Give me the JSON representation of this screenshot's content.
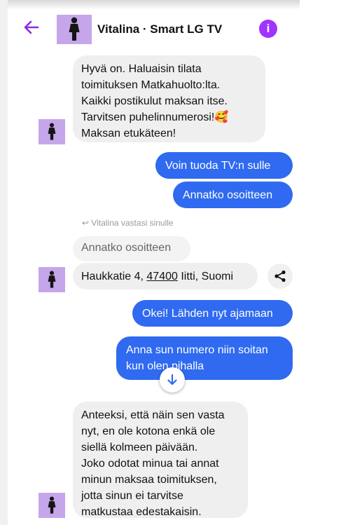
{
  "header": {
    "title": "Vitalina · Smart LG TV",
    "back_icon": "back-arrow-icon",
    "info_icon": "info-icon",
    "info_glyph": "i",
    "accent_color": "#a033ff"
  },
  "colors": {
    "outgoing_bubble": "#2f6af0",
    "incoming_bubble": "#efefef",
    "avatar_bg": "#c6a6ea"
  },
  "messages": {
    "m1_lines": [
      "Hyvä on. Haluaisin tilata",
      "toimituksen Matkahuolto:lta.",
      "Kaikki postikulut maksan itse.",
      "Tarvitsen puhelinnumerosi!🥰",
      "Maksan etukäteen!"
    ],
    "m2": "Voin tuoda TV:n sulle",
    "m3": "Annatko osoitteen",
    "reply_note": "Vitalina vastasi sinulle",
    "quoted": "Annatko osoitteen",
    "address_pre": "Haukkatie 4, ",
    "address_zip": "47400",
    "address_post": " Iitti, Suomi",
    "m5": "Okei! Lähden nyt ajamaan",
    "m6_line1": "Anna sun numero niin soitan",
    "m6_line2": "kun olen pihalla",
    "m7_lines": [
      "Anteeksi, että näin sen vasta",
      "nyt, en ole kotona enkä ole",
      "siellä kolmeen päivään.",
      "Joko odotat minua tai annat",
      "minun maksaa toimituksen,",
      "jotta sinun ei tarvitse",
      "matkustaa edestakaisin."
    ]
  }
}
